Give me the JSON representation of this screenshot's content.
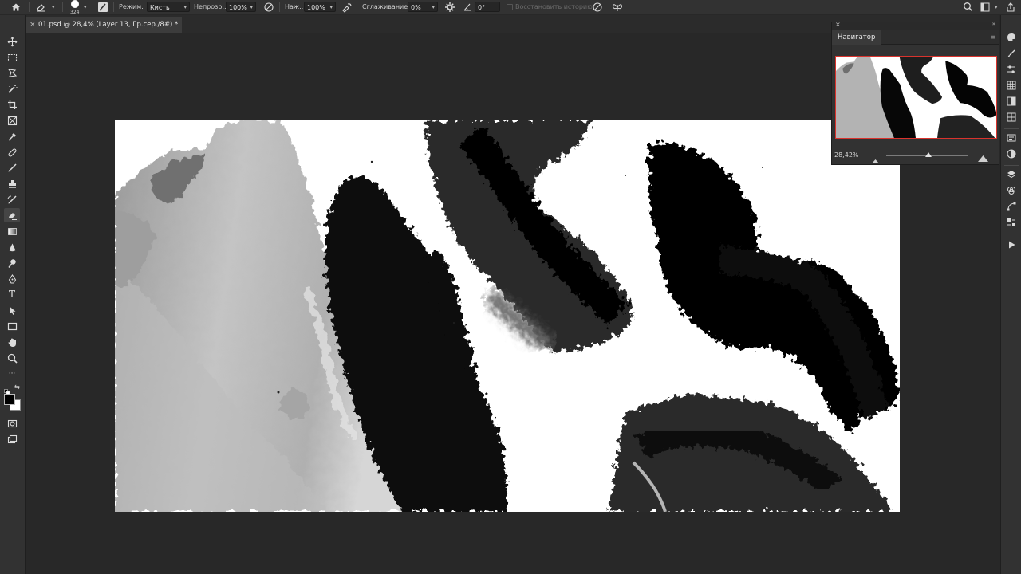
{
  "options_bar": {
    "brush_size": "324",
    "mode_label": "Режим:",
    "mode_value": "Кисть",
    "opacity_label": "Непрозр.:",
    "opacity_value": "100%",
    "flow_label": "Наж.:",
    "flow_value": "100%",
    "smoothing_label": "Сглаживание:",
    "smoothing_value": "0%",
    "angle_value": "0°",
    "history_label": "Восстановить историю"
  },
  "document": {
    "tab_title": "01.psd @ 28,4% (Layer 13, Гр.сер./8#) *",
    "close_glyph": "×"
  },
  "navigator": {
    "title": "Навигатор",
    "zoom_value": "28,42%",
    "slider_level": 0.52,
    "close_glyph": "×",
    "collapse_glyph": "»",
    "menu_glyph": "≡"
  },
  "toolbar": {
    "tools": [
      "move-tool",
      "marquee-tool",
      "lasso-tool",
      "magic-wand-tool",
      "crop-tool",
      "frame-tool",
      "eyedropper-tool",
      "healing-tool",
      "brush-tool",
      "stamp-tool",
      "history-brush-tool",
      "eraser-tool",
      "gradient-tool",
      "blur-tool",
      "dodge-tool",
      "pen-tool",
      "type-tool",
      "path-select-tool",
      "rectangle-tool",
      "hand-tool",
      "zoom-tool",
      "more-tools"
    ],
    "active_tool": "eraser-tool",
    "type_glyph": "T",
    "more_glyph": "···"
  },
  "colors": {
    "foreground": "#000000",
    "background": "#ffffff",
    "accent": "#d9332d",
    "ui_panel": "#323232",
    "workspace": "#282828"
  }
}
